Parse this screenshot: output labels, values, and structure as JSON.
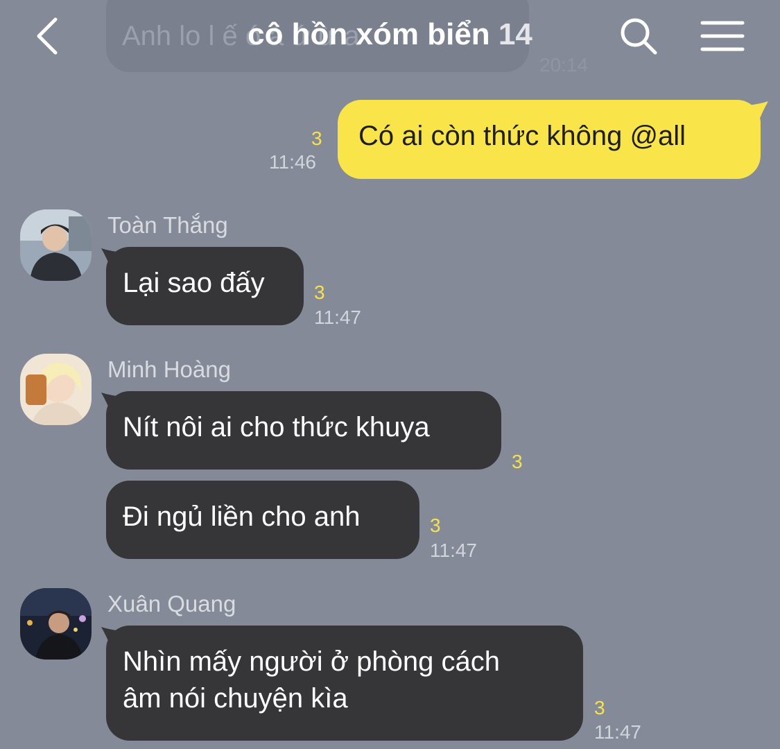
{
  "previous": {
    "text": "Anh lo l  ế  ó   á  ứ   ừ  a",
    "time": "20:14"
  },
  "header": {
    "title": "cô hồn xóm biển",
    "member_count": "14"
  },
  "messages": {
    "m1": {
      "text": "Có ai còn thức không @all",
      "unread": "3",
      "time": "11:46"
    },
    "toan": {
      "sender": "Toàn Thắng",
      "text": "Lại sao đấy",
      "unread": "3",
      "time": "11:47"
    },
    "minh": {
      "sender": "Minh Hoàng",
      "text1": "Nít nôi ai cho thức khuya",
      "unread1": "3",
      "text2": "Đi ngủ liền cho anh",
      "unread2": "3",
      "time2": "11:47"
    },
    "xuan": {
      "sender": "Xuân Quang",
      "line1": "Nhìn mấy người ở phòng cách",
      "line2": "âm nói chuyện kìa",
      "unread": "3",
      "time": "11:47"
    }
  },
  "colors": {
    "background": "#848a98",
    "my_bubble": "#f9e54a",
    "their_bubble": "#363638",
    "unread": "#f7e24d"
  }
}
